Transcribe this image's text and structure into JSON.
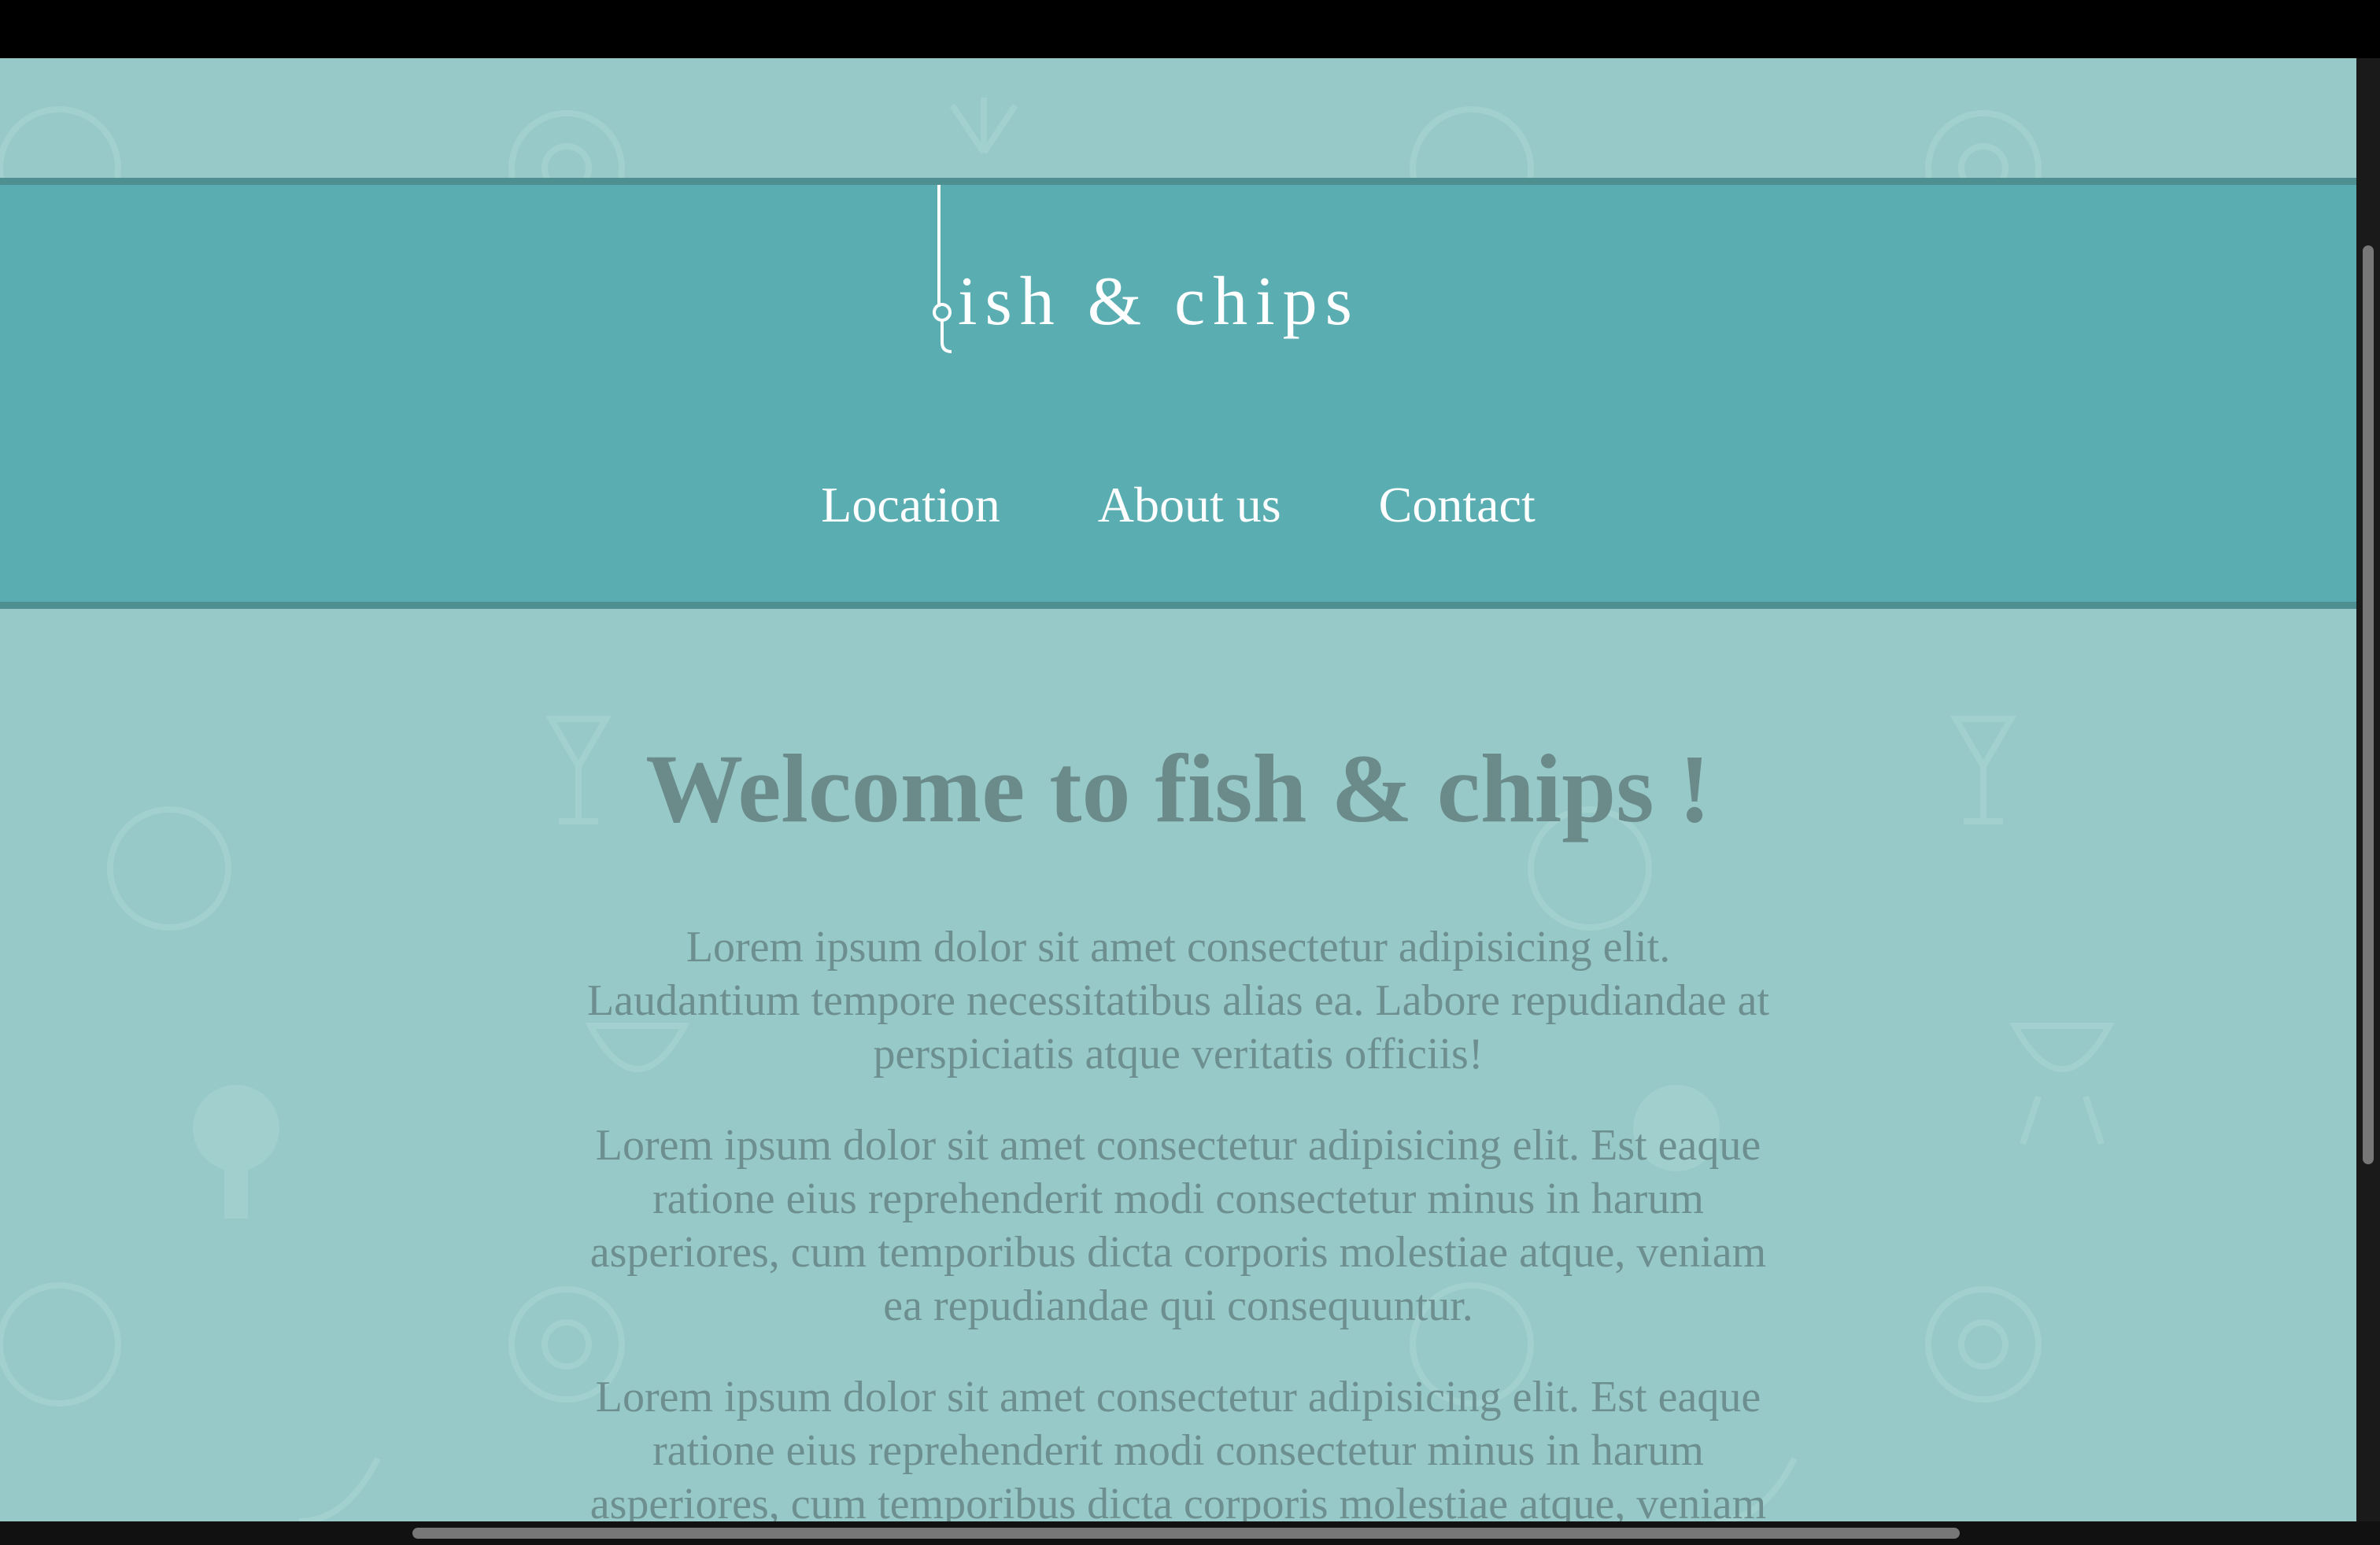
{
  "site": {
    "logo_text": "ish & chips"
  },
  "nav": {
    "items": [
      {
        "label": "Location"
      },
      {
        "label": "About us"
      },
      {
        "label": "Contact"
      }
    ]
  },
  "main": {
    "heading": "Welcome to fish & chips !",
    "paragraphs": [
      "Lorem ipsum dolor sit amet consectetur adipisicing elit. Laudantium tempore necessitatibus alias ea. Labore repudiandae at perspiciatis atque veritatis officiis!",
      "Lorem ipsum dolor sit amet consectetur adipisicing elit. Est eaque ratione eius reprehenderit modi consectetur minus in harum asperiores, cum temporibus dicta corporis molestiae atque, veniam ea repudiandae qui consequuntur.",
      "Lorem ipsum dolor sit amet consectetur adipisicing elit. Est eaque ratione eius reprehenderit modi consectetur minus in harum asperiores, cum temporibus dicta corporis molestiae atque, veniam ea repudiandae qui consequuntur."
    ]
  },
  "colors": {
    "page_background": "#97c9c8",
    "header_background": "#5aaeb1",
    "header_border": "#4e8f91",
    "heading_text": "#6b8b8b",
    "body_text": "#6d8f8f",
    "nav_text": "#ffffff"
  }
}
